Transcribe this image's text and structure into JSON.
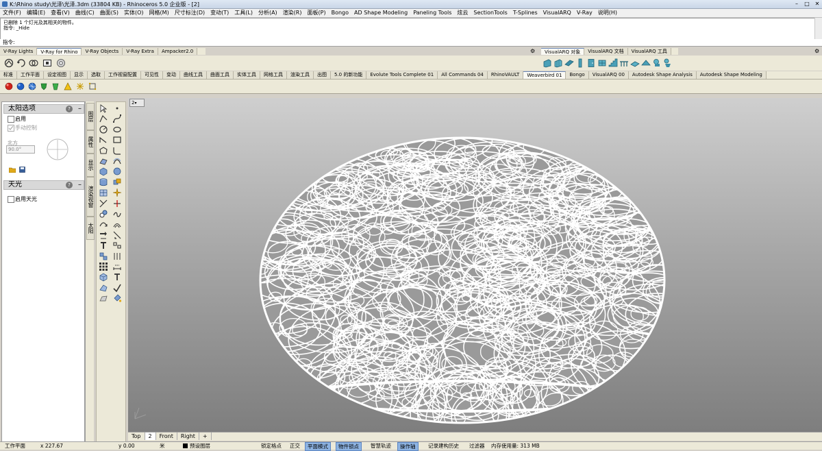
{
  "window": {
    "title": "K:\\Rhino study\\光泽\\光泽.3dm (33804 KB) - Rhinoceros 5.0 企业版 - [2]",
    "minimize": "–",
    "maximize": "□",
    "close": "✕"
  },
  "menu": [
    "文件(F)",
    "编辑(E)",
    "查看(V)",
    "曲线(C)",
    "曲面(S)",
    "实体(O)",
    "网格(M)",
    "尺寸标注(D)",
    "变动(T)",
    "工具(L)",
    "分析(A)",
    "渲染(R)",
    "面板(P)",
    "Bongo",
    "AD Shape Modeling",
    "Paneling Tools",
    "炫云",
    "SectionTools",
    "T-Splines",
    "VisualARQ",
    "V-Ray",
    "说明(H)"
  ],
  "command": {
    "history_line1": "已删除 1 个灯光及其相关的物件。",
    "history_line2": "指令: _Hide",
    "prompt": "指令:"
  },
  "toolbar_tabs_left": [
    "V-Ray Lights",
    "V-Ray for Rhino",
    "V-Ray Objects",
    "V-Ray Extra",
    "Ampacker2.0"
  ],
  "toolbar_tabs_left_active": 1,
  "toolbar_tabs_right": [
    "VisualARQ 对象",
    "VisualARQ 文档",
    "VisualARQ 工具"
  ],
  "toolbar_tabs_right_active": 0,
  "main_tabs": [
    "标准",
    "工作平面",
    "设定视图",
    "显示",
    "选取",
    "工作视窗配置",
    "可见性",
    "变动",
    "曲线工具",
    "曲面工具",
    "实体工具",
    "网格工具",
    "渲染工具",
    "出图",
    "5.0 的新功能",
    "Evolute Tools Complete 01",
    "All Commands 04",
    "RhinoVAULT",
    "Weaverbird 01",
    "Bongo",
    "VisualARQ 00",
    "Autodesk Shape Analysis",
    "Autodesk Shape Modeling"
  ],
  "main_tabs_active": 18,
  "left_panel": {
    "sun_title": "太阳选项",
    "sun_enable": "启用",
    "sun_manual": "手动控制",
    "north_label": "北方",
    "north_value": "90.0°",
    "sky_title": "天光",
    "sky_enable": "启用天光",
    "help": "?",
    "collapse": "–"
  },
  "side_tabs": [
    "图层",
    "属性",
    "显示",
    "渲染视窗",
    "太阳"
  ],
  "viewport": {
    "label": "2",
    "tabs": [
      "Top",
      "2",
      "Front",
      "Right"
    ],
    "active_tab": 1,
    "add_tab": "+"
  },
  "statusbar": {
    "workplane": "工作平面",
    "x": "x 227.67",
    "y": "y 0.00",
    "unit": "米",
    "layer": "预设图层",
    "snap_lock": "锁定格点",
    "ortho": "正交",
    "planar": "平面模式",
    "osnap": "物件锁点",
    "smarttrack": "智慧轨迹",
    "gumball": "操作轴",
    "history": "记录建构历史",
    "filter": "过滤器",
    "memory": "内存使用量: 313 MB"
  },
  "status_on": {
    "planar": true,
    "osnap": true,
    "gumball": true
  },
  "colors": {
    "background": "#d4d0c8",
    "accent": "#8db3e2",
    "mesh": "#ffffff"
  }
}
